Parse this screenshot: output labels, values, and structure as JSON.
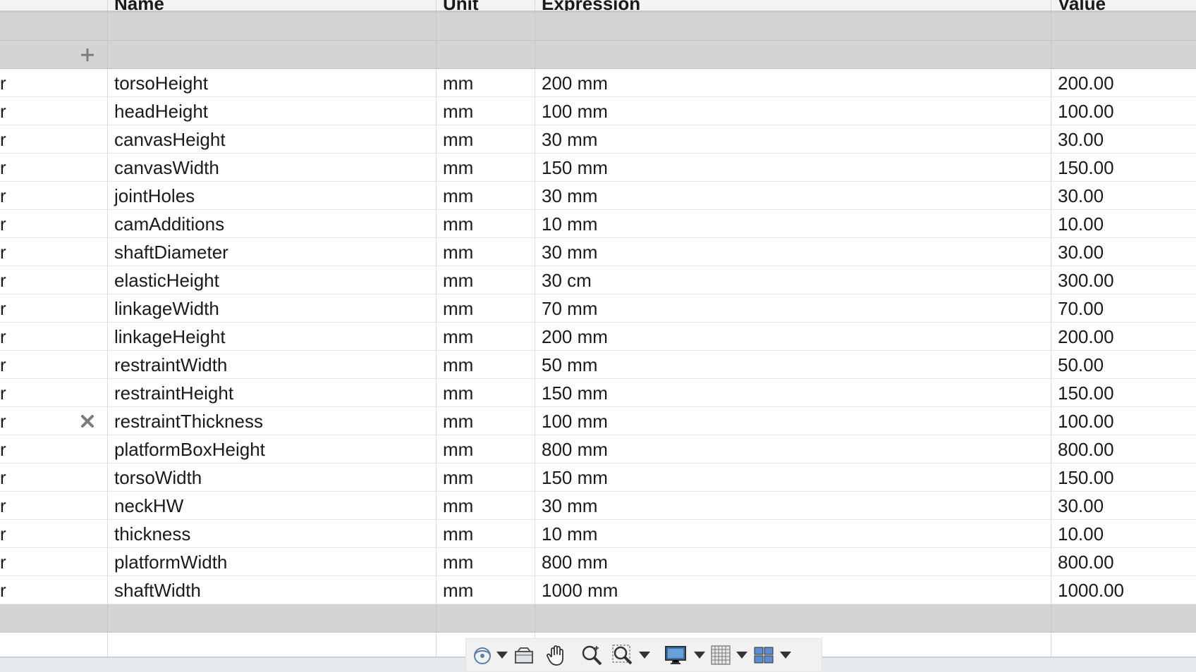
{
  "table": {
    "columns": [
      "Name",
      "Unit",
      "Expression",
      "Value"
    ],
    "add_row_icon": "plus-icon",
    "delete_row_icon": "close-icon",
    "rows": [
      {
        "type": "r",
        "name": "torsoHeight",
        "unit": "mm",
        "expression": "200 mm",
        "value": "200.00"
      },
      {
        "type": "r",
        "name": "headHeight",
        "unit": "mm",
        "expression": "100 mm",
        "value": "100.00"
      },
      {
        "type": "r",
        "name": "canvasHeight",
        "unit": "mm",
        "expression": "30 mm",
        "value": "30.00"
      },
      {
        "type": "r",
        "name": "canvasWidth",
        "unit": "mm",
        "expression": "150 mm",
        "value": "150.00"
      },
      {
        "type": "r",
        "name": "jointHoles",
        "unit": "mm",
        "expression": "30 mm",
        "value": "30.00"
      },
      {
        "type": "r",
        "name": "camAdditions",
        "unit": "mm",
        "expression": "10 mm",
        "value": "10.00"
      },
      {
        "type": "r",
        "name": "shaftDiameter",
        "unit": "mm",
        "expression": "30 mm",
        "value": "30.00"
      },
      {
        "type": "r",
        "name": "elasticHeight",
        "unit": "mm",
        "expression": "30 cm",
        "value": "300.00"
      },
      {
        "type": "r",
        "name": "linkageWidth",
        "unit": "mm",
        "expression": "70 mm",
        "value": "70.00"
      },
      {
        "type": "r",
        "name": "linkageHeight",
        "unit": "mm",
        "expression": "200 mm",
        "value": "200.00"
      },
      {
        "type": "r",
        "name": "restraintWidth",
        "unit": "mm",
        "expression": "50 mm",
        "value": "50.00"
      },
      {
        "type": "r",
        "name": "restraintHeight",
        "unit": "mm",
        "expression": "150 mm",
        "value": "150.00"
      },
      {
        "type": "r",
        "name": "restraintThickness",
        "unit": "mm",
        "expression": "100 mm",
        "value": "100.00",
        "hovered": true
      },
      {
        "type": "r",
        "name": "platformBoxHeight",
        "unit": "mm",
        "expression": "800 mm",
        "value": "800.00"
      },
      {
        "type": "r",
        "name": "torsoWidth",
        "unit": "mm",
        "expression": "150 mm",
        "value": "150.00"
      },
      {
        "type": "r",
        "name": "neckHW",
        "unit": "mm",
        "expression": "30 mm",
        "value": "30.00"
      },
      {
        "type": "r",
        "name": "thickness",
        "unit": "mm",
        "expression": "10 mm",
        "value": "10.00"
      },
      {
        "type": "r",
        "name": "platformWidth",
        "unit": "mm",
        "expression": "800 mm",
        "value": "800.00"
      },
      {
        "type": "r",
        "name": "shaftWidth",
        "unit": "mm",
        "expression": "1000 mm",
        "value": "1000.00"
      }
    ]
  },
  "navbar": {
    "tools": [
      {
        "name": "orbit-icon",
        "dropdown": true
      },
      {
        "name": "look-at-icon",
        "dropdown": false
      },
      {
        "name": "pan-hand-icon",
        "dropdown": false
      },
      {
        "name": "zoom-icon",
        "dropdown": false
      },
      {
        "name": "fit-window-icon",
        "dropdown": true
      },
      {
        "name": "display-settings-icon",
        "dropdown": true
      },
      {
        "name": "grid-snaps-icon",
        "dropdown": true
      },
      {
        "name": "viewports-icon",
        "dropdown": true
      }
    ]
  }
}
